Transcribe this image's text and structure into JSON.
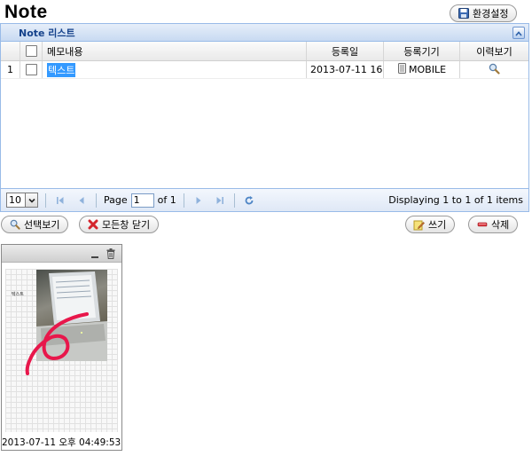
{
  "header": {
    "title": "Note",
    "settings_label": "환경설정"
  },
  "grid": {
    "title": "Note 리스트",
    "columns": {
      "memo": "메모내용",
      "date": "등록일",
      "device": "등록기기",
      "history": "이력보기"
    },
    "rows": [
      {
        "num": "1",
        "memo": "텍스트",
        "date": "2013-07-11 16:",
        "device": "MOBILE"
      }
    ]
  },
  "pager": {
    "page_size": "10",
    "page_label": "Page",
    "page_value": "1",
    "of_label": "of 1",
    "info": "Displaying 1 to 1 of 1 items"
  },
  "actions": {
    "view_selected": "선택보기",
    "close_all": "모든창 닫기",
    "write": "쓰기",
    "delete": "삭제"
  },
  "note_card": {
    "thumb_text": "텍스트",
    "timestamp": "2013-07-11 오후 04:49:53"
  },
  "colors": {
    "header_text": "#15428b",
    "selection": "#3399ff",
    "pager_icon": "#4f86c6",
    "ink_stroke": "#e8174b",
    "delete_icon": "#d9363e"
  },
  "icons": {
    "settings": "floppy-disk-icon",
    "collapse": "chevron-up-icon",
    "history": "magnifier-icon",
    "device": "mobile-device-icon",
    "refresh": "refresh-icon",
    "view_selected": "magnifier-icon",
    "close_all": "red-x-icon",
    "write": "pencil-note-icon",
    "delete": "minus-delete-icon",
    "minimize": "minimize-icon",
    "trash": "trash-icon"
  }
}
